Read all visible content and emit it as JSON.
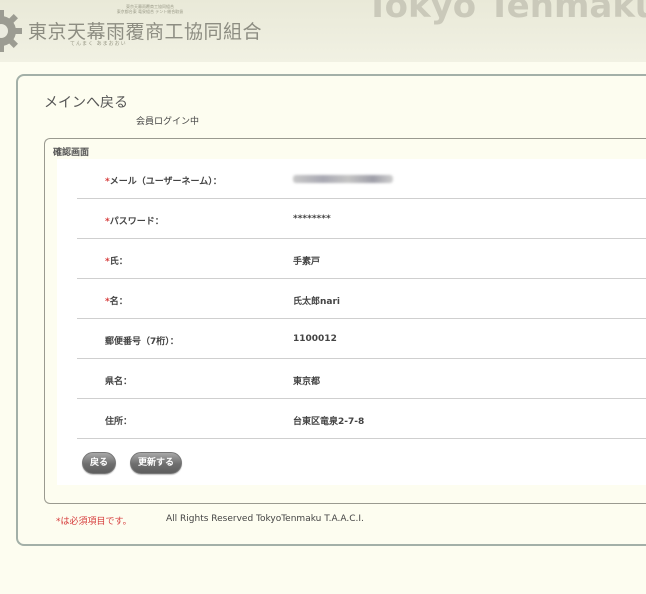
{
  "header": {
    "logo_title": "東京天幕雨覆商工協同組合",
    "logo_small_lines": [
      "東京天幕雨覆商工協同組合",
      "東京都台東 竜泉組合 テント総合取扱"
    ],
    "logo_ruby": "てんまく あまおおい",
    "brand_en": "Tokyo Tenmaku A"
  },
  "nav": {
    "back_to_main": "メインへ戻る",
    "login_status": "会員ログイン中"
  },
  "form": {
    "legend": "確認画面",
    "rows": [
      {
        "required_mark": "*",
        "label": "メール（ユーザーネーム）：",
        "value": "",
        "blurred": true
      },
      {
        "required_mark": "*",
        "label": "パスワード：",
        "value": "********"
      },
      {
        "required_mark": "*",
        "label": "氏：",
        "value": "手素戸"
      },
      {
        "required_mark": "*",
        "label": "名：",
        "value": "氏太郎nari"
      },
      {
        "required_mark": "",
        "label": "郵便番号（7桁）：",
        "value": "1100012"
      },
      {
        "required_mark": "",
        "label": "県名：",
        "value": "東京都"
      },
      {
        "required_mark": "",
        "label": "住所：",
        "value": "台東区竜泉2-7-8"
      }
    ],
    "buttons": {
      "back": "戻る",
      "update": "更新する"
    }
  },
  "footer": {
    "required_note": "*は必須項目です。",
    "copyright": "All Rights Reserved TokyoTenmaku T.A.A.C.I."
  },
  "colors": {
    "page_bg": "#fdfdf0",
    "panel_border": "#a3b0a8",
    "required_red": "#d63b3b",
    "button_gray": "#6e6e6e"
  }
}
